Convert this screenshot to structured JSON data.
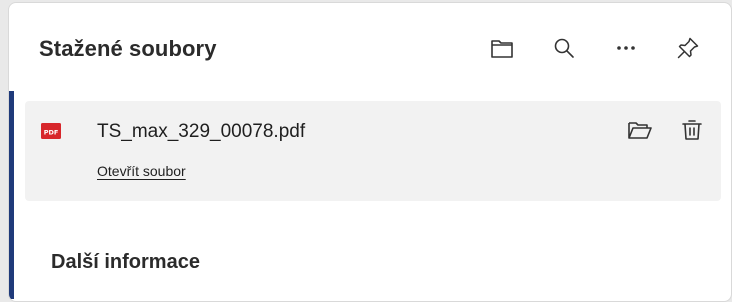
{
  "header": {
    "title": "Stažené soubory",
    "icons": [
      "folder-icon",
      "search-icon",
      "more-icon",
      "pin-icon"
    ]
  },
  "download": {
    "file_name": "TS_max_329_00078.pdf",
    "file_type_badge": "PDF",
    "open_link": "Otevřít soubor",
    "icons": [
      "pdf-file-icon",
      "open-folder-icon",
      "trash-icon"
    ]
  },
  "footer": {
    "more_info": "Další informace"
  },
  "colors": {
    "accent": "#1f3a7a",
    "pdf_red": "#d7262b",
    "item_background": "#f2f2f2"
  }
}
